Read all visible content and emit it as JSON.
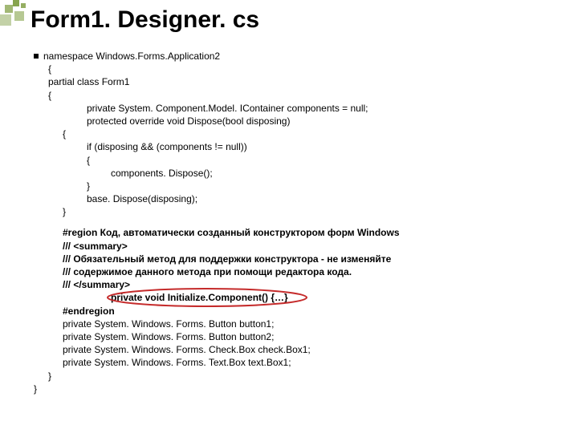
{
  "title": "Form1. Designer. cs",
  "code": {
    "l1": "namespace Windows.Forms.Application2",
    "l2": "{",
    "l3": "partial class Form1",
    "l4": "{",
    "l5": "private System. Component.Model. IContainer components = null;",
    "l6": "protected override void Dispose(bool disposing)",
    "l7": "{",
    "l8": "if (disposing && (components != null))",
    "l9": "{",
    "l10": "components. Dispose();",
    "l11": "}",
    "l12": "base. Dispose(disposing);",
    "l13": "}",
    "r1": "#region Код, автоматически созданный конструктором форм Windows",
    "r2": "/// <summary>",
    "r3": "/// Обязательный метод для поддержки конструктора - не изменяйте",
    "r4": "/// содержимое данного метода при помощи редактора кода.",
    "r5": "/// </summary>",
    "r6": "private void Initialize.Component() {…}",
    "r7": "#endregion",
    "p1": "private System. Windows. Forms. Button button1;",
    "p2": "private System. Windows. Forms. Button button2;",
    "p3": "private System. Windows. Forms. Check.Box check.Box1;",
    "p4": "private System. Windows. Forms. Text.Box text.Box1;",
    "e1": "}",
    "e2": "}"
  }
}
